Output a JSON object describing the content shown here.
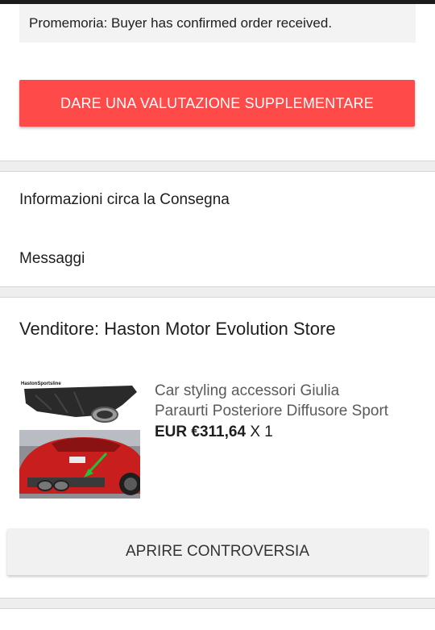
{
  "reminder": {
    "text": "Promemoria: Buyer has confirmed order received."
  },
  "actions": {
    "rate_label": "DARE UNA VALUTAZIONE SUPPLEMENTARE",
    "dispute_label": "APRIRE CONTROVERSIA"
  },
  "menu": {
    "delivery_info": "Informazioni circa la Consegna",
    "messages": "Messaggi"
  },
  "seller": {
    "label": "Venditore: Haston Motor Evolution Store"
  },
  "product": {
    "title_line1": "Car styling accessori Giulia",
    "title_line2": "Paraurti Posteriore Diffusore Sport",
    "price": "EUR €311,64",
    "quantity": "X 1",
    "image_watermark": "HastonSportsline"
  },
  "colors": {
    "accent": "#ff4a4a",
    "car_red": "#c81e1e",
    "arrow_green": "#22c33a"
  }
}
